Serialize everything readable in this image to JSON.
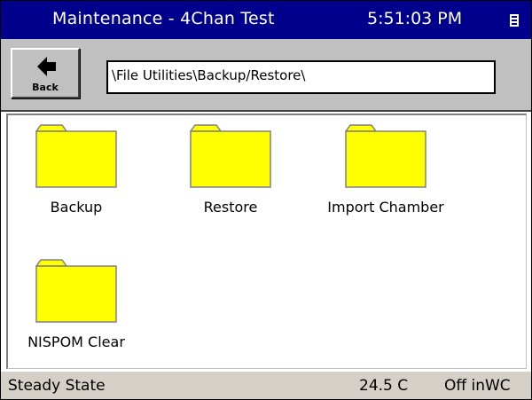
{
  "titlebar": {
    "title": "Maintenance - 4Chan Test",
    "time": "5:51:03 PM",
    "menu_icon": "menu-icon"
  },
  "toolbar": {
    "back_label": "Back",
    "back_icon": "left-arrow-icon",
    "path": "\\File Utilities\\Backup/Restore\\"
  },
  "folders": [
    {
      "label": "Backup",
      "icon": "folder-icon"
    },
    {
      "label": "Restore",
      "icon": "folder-icon"
    },
    {
      "label": "Import Chamber",
      "icon": "folder-icon"
    },
    {
      "label": "NISPOM Clear",
      "icon": "folder-icon"
    }
  ],
  "status": {
    "state": "Steady State",
    "temperature": "24.5 C",
    "pressure": "Off inWC"
  },
  "colors": {
    "titlebar_bg": "#00008c",
    "folder_fill": "#ffff00",
    "chrome_gray": "#c0c0c0"
  }
}
